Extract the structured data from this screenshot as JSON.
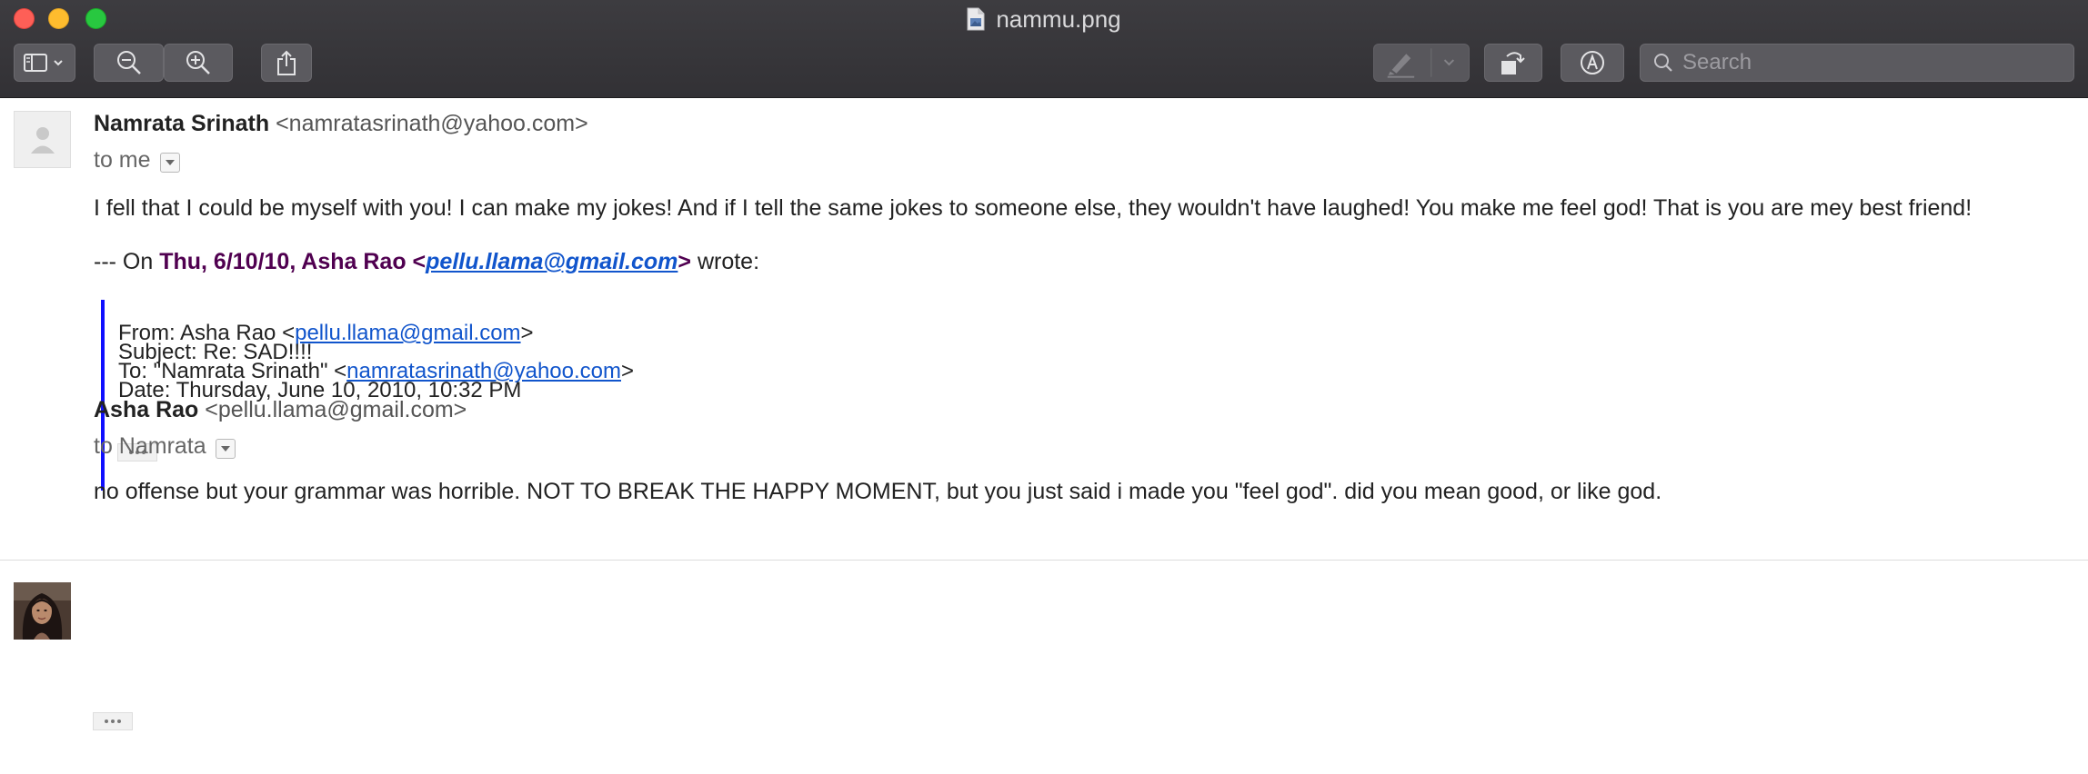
{
  "window": {
    "title": "nammu.png"
  },
  "toolbar": {
    "search_placeholder": "Search"
  },
  "messages": [
    {
      "sender_name": "Namrata Srinath",
      "sender_email": "<namratasrinath@yahoo.com>",
      "to_label": "to me",
      "body": "I fell that I could be myself with you! I can make my jokes! And if I tell the same jokes to someone else, they wouldn't have laughed! You make me feel god! That is you are mey best friend!",
      "quote": {
        "intro_prefix": "--- On ",
        "intro_date": "Thu, 6/10/10, Asha Rao <",
        "intro_link": "pellu.llama@gmail.com",
        "intro_close": ">",
        "intro_suffix": " wrote:",
        "from_prefix": "From: Asha Rao <",
        "from_link": "pellu.llama@gmail.com",
        "from_suffix": ">",
        "subject": "Subject: Re: SAD!!!!",
        "to_prefix": "To: \"Namrata Srinath\" <",
        "to_link": "namratasrinath@yahoo.com",
        "to_suffix": ">",
        "date": "Date: Thursday, June 10, 2010, 10:32 PM"
      }
    },
    {
      "sender_name": "Asha Rao",
      "sender_email": "<pellu.llama@gmail.com>",
      "to_label": "to Namrata",
      "body": "no offense but your grammar was horrible. NOT TO BREAK THE HAPPY MOMENT, but you just said i made you \"feel god\". did you mean good, or like god."
    }
  ],
  "colors": {
    "titlebar": "#363539",
    "link": "#1155cc",
    "quote_bar": "#1010ff",
    "quote_date": "#500050"
  },
  "icons": [
    "close-button",
    "minimize-button",
    "zoom-button",
    "document-icon",
    "sidebar-icon",
    "chevron-down-icon",
    "zoom-out-icon",
    "zoom-in-icon",
    "share-icon",
    "highlight-icon",
    "rotate-icon",
    "markup-icon",
    "search-icon",
    "person-icon",
    "ellipsis-icon"
  ]
}
